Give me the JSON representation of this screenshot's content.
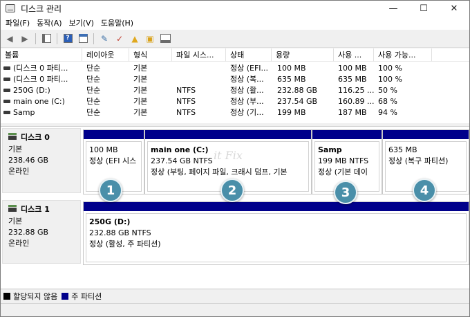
{
  "window": {
    "title": "디스크 관리",
    "minimize_glyph": "—",
    "maximize_glyph": "☐",
    "close_glyph": "✕"
  },
  "menu": [
    "파일(F)",
    "동작(A)",
    "보기(V)",
    "도움말(H)"
  ],
  "toolbar_icons": [
    "back-arrow-icon",
    "forward-arrow-icon",
    "console-icon",
    "help-icon",
    "properties-icon",
    "connect-icon",
    "check-icon",
    "folder-up-icon",
    "search-folder-icon",
    "disk-view-icon"
  ],
  "columns": [
    "볼륨",
    "레이아웃",
    "형식",
    "파일 시스...",
    "상태",
    "용량",
    "사용 ...",
    "사용 가능..."
  ],
  "volumes": [
    {
      "name": "(디스크 0 파티...",
      "layout": "단순",
      "type": "기본",
      "fs": "",
      "status": "정상 (EFI...",
      "capacity": "100 MB",
      "free": "100 MB",
      "pct": "100 %"
    },
    {
      "name": "(디스크 0 파티...",
      "layout": "단순",
      "type": "기본",
      "fs": "",
      "status": "정상 (복...",
      "capacity": "635 MB",
      "free": "635 MB",
      "pct": "100 %"
    },
    {
      "name": "250G (D:)",
      "layout": "단순",
      "type": "기본",
      "fs": "NTFS",
      "status": "정상 (활...",
      "capacity": "232.88 GB",
      "free": "116.25 ...",
      "pct": "50 %"
    },
    {
      "name": "main one (C:)",
      "layout": "단순",
      "type": "기본",
      "fs": "NTFS",
      "status": "정상 (부...",
      "capacity": "237.54 GB",
      "free": "160.89 ...",
      "pct": "68 %"
    },
    {
      "name": "Samp",
      "layout": "단순",
      "type": "기본",
      "fs": "NTFS",
      "status": "정상 (기...",
      "capacity": "199 MB",
      "free": "187 MB",
      "pct": "94 %"
    }
  ],
  "disks": [
    {
      "title": "디스크 0",
      "kind": "기본",
      "size": "238.46 GB",
      "state": "온라인",
      "partitions": [
        {
          "name": "",
          "size": "100 MB",
          "status": "정상 (EFI 시스"
        },
        {
          "name": "main one  (C:)",
          "size": "237.54 GB NTFS",
          "status": "정상 (부팅, 페이지 파일, 크래시 덤프, 기본"
        },
        {
          "name": "Samp",
          "size": "199 MB NTFS",
          "status": "정상 (기본 데이"
        },
        {
          "name": "",
          "size": "635 MB",
          "status": "정상 (복구 파티션)"
        }
      ]
    },
    {
      "title": "디스크 1",
      "kind": "기본",
      "size": "232.88 GB",
      "state": "온라인",
      "partitions": [
        {
          "name": "250G  (D:)",
          "size": "232.88 GB NTFS",
          "status": "정상 (활성, 주 파티션)"
        }
      ]
    }
  ],
  "badges": [
    "1",
    "2",
    "3",
    "4"
  ],
  "watermark": "it Fix",
  "legend": [
    {
      "label": "할당되지 않음",
      "color": "#000000"
    },
    {
      "label": "주 파티션",
      "color": "#00008b"
    }
  ],
  "colors": {
    "partition_bar": "#00008b",
    "badge": "#4a8fa9"
  }
}
